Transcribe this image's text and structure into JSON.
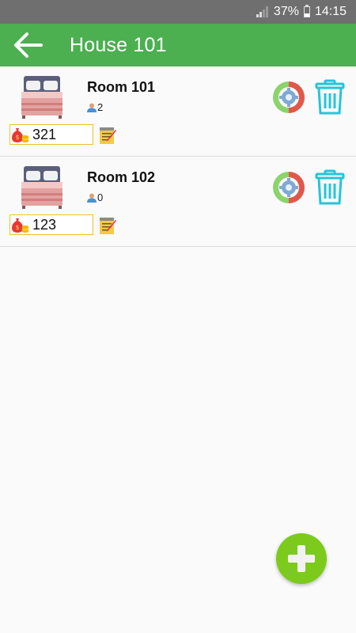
{
  "status_bar": {
    "battery": "37%",
    "time": "14:15"
  },
  "app_bar": {
    "title": "House 101"
  },
  "rooms": [
    {
      "name": "Room 101",
      "occupants": "2",
      "price": "321"
    },
    {
      "name": "Room 102",
      "occupants": "0",
      "price": "123"
    }
  ],
  "colors": {
    "app_bar": "#4caf50",
    "status_bar": "#6f6f6f",
    "fab": "#7ccb1c",
    "price_border": "#e8c330",
    "delete_icon": "#25c5d9"
  },
  "icons": {
    "back": "arrow-left-icon",
    "bed": "bed-icon",
    "person": "person-icon",
    "money": "money-bag-icon",
    "edit": "notepad-edit-icon",
    "settings": "refresh-gear-icon",
    "delete": "trash-icon",
    "add": "plus-icon"
  }
}
